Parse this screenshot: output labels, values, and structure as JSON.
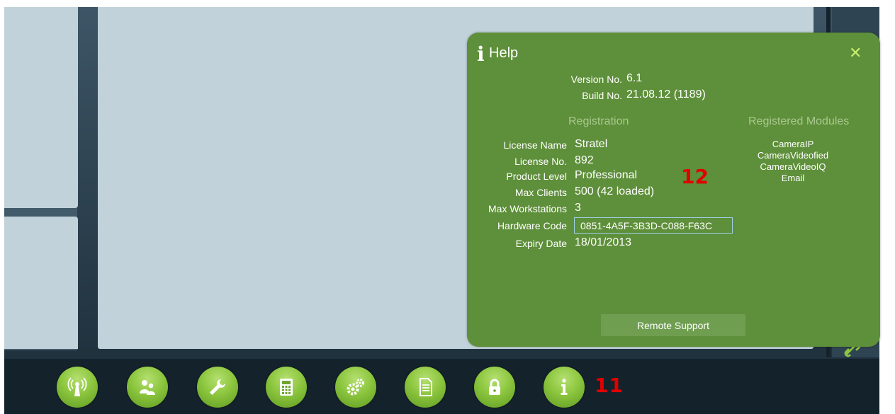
{
  "dock": {
    "items": [
      {
        "name": "antenna-icon"
      },
      {
        "name": "users-icon"
      },
      {
        "name": "wrench-icon"
      },
      {
        "name": "calculator-icon"
      },
      {
        "name": "gears-icon"
      },
      {
        "name": "document-icon"
      },
      {
        "name": "lock-icon"
      },
      {
        "name": "info-icon"
      }
    ],
    "annotation": "11"
  },
  "help": {
    "icon_glyph": "i",
    "title": "Help",
    "close_glyph": "✕",
    "version_label": "Version No.",
    "version_value": "6.1",
    "build_label": "Build No.",
    "build_value": "21.08.12 (1189)",
    "registration_heading": "Registration",
    "modules_heading": "Registered Modules",
    "license_name_label": "License Name",
    "license_name_value": "Stratel",
    "license_no_label": "License No.",
    "license_no_value": "892",
    "product_level_label": "Product Level",
    "product_level_value": "Professional",
    "max_clients_label": "Max Clients",
    "max_clients_value": "500 (42 loaded)",
    "max_workstations_label": "Max Workstations",
    "max_workstations_value": "3",
    "hardware_code_label": "Hardware Code",
    "hardware_code_value": "0851-4A5F-3B3D-C088-F63C",
    "expiry_label": "Expiry Date",
    "expiry_value": "18/01/2013",
    "modules": [
      "CameraIP",
      "CameraVideofied",
      "CameraVideoIQ",
      "Email"
    ],
    "annotation": "12",
    "remote_support_label": "Remote Support"
  },
  "colors": {
    "panel_green": "#5e8f3a",
    "dock_green": "#8cc63e",
    "annotation_red": "#e00000",
    "close_green": "#c7ef6e"
  }
}
